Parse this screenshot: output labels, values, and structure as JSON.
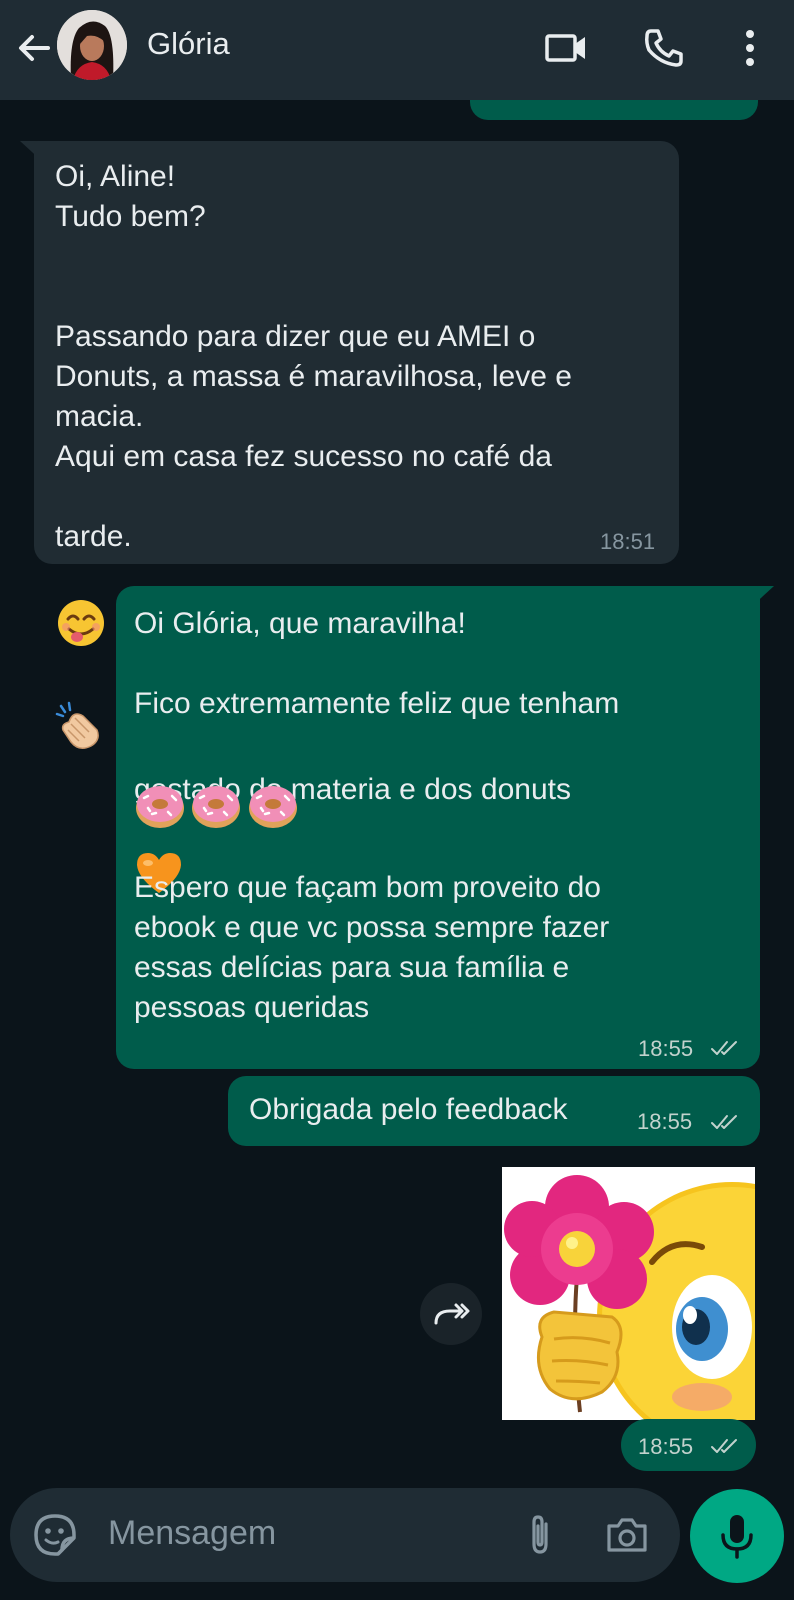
{
  "header": {
    "contact_name": "Glória",
    "icons": [
      "back-arrow-icon",
      "video-call-icon",
      "phone-icon",
      "more-vert-icon"
    ]
  },
  "messages": [
    {
      "direction": "in",
      "text_lines": "Oi, Aline!\nTudo bem?\n\n\nPassando para dizer que eu AMEI o\nDonuts, a massa é maravilhosa, leve e\nmacia.\nAqui em casa fez sucesso no café da",
      "last_line": "tarde.",
      "emojis": [
        "😋",
        "👏"
      ],
      "time": "18:51"
    },
    {
      "direction": "out",
      "text_a": "Oi Glória, que maravilha!\n\nFico extremamente feliz que tenham",
      "text_b": "gostado do materia e dos donuts",
      "emoji_heart": "🧡",
      "emoji_donuts": "🍩🍩🍩",
      "text_c": "Espero que façam bom proveito do\nebook e que vc possa sempre fazer\nessas delícias para sua família e\npessoas queridas",
      "time": "18:55",
      "status": "read"
    },
    {
      "direction": "out",
      "text": "Obrigada pelo feedback",
      "time": "18:55",
      "status": "read"
    },
    {
      "direction": "out",
      "type": "image",
      "image_description": "sticker-flower-smiley",
      "time": "18:55",
      "status": "read"
    }
  ],
  "composer": {
    "placeholder": "Mensagem",
    "icons": [
      "sticker-icon",
      "attach-icon",
      "camera-icon",
      "mic-icon"
    ]
  },
  "colors": {
    "background": "#0b141a",
    "header": "#1f2c34",
    "incoming_bubble": "#202c33",
    "outgoing_bubble": "#005c4b",
    "accent": "#00a884",
    "read_ticks": "#c2d2cd"
  }
}
